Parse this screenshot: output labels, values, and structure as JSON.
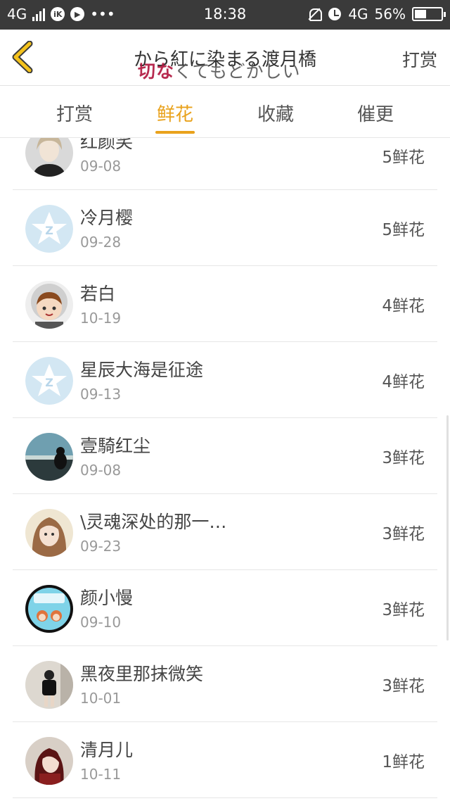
{
  "status_bar": {
    "network": "4G",
    "time": "18:38",
    "network_right": "4G",
    "battery": "56%",
    "more": "•••",
    "app_icon_label": "iK"
  },
  "header": {
    "title": "から紅に染まる渡月橋",
    "right_label": "打赏",
    "overlay_prefix": "切な",
    "overlay_rest": "くてもどかしい"
  },
  "tabs": [
    {
      "label": "打赏"
    },
    {
      "label": "鲜花"
    },
    {
      "label": "收藏"
    },
    {
      "label": "催更"
    }
  ],
  "rows": [
    {
      "name": "红颜笑",
      "date": "09-08",
      "amount": "5鲜花"
    },
    {
      "name": "冷月樱",
      "date": "09-28",
      "amount": "5鲜花"
    },
    {
      "name": "若白",
      "date": "10-19",
      "amount": "4鲜花"
    },
    {
      "name": "星辰大海是征途",
      "date": "09-13",
      "amount": "4鲜花"
    },
    {
      "name": "壹騎红尘",
      "date": "09-08",
      "amount": "3鲜花"
    },
    {
      "name": "\\灵魂深处的那一…",
      "date": "09-23",
      "amount": "3鲜花"
    },
    {
      "name": "颜小慢",
      "date": "09-10",
      "amount": "3鲜花"
    },
    {
      "name": "黑夜里那抹微笑",
      "date": "10-01",
      "amount": "3鲜花"
    },
    {
      "name": "清月儿",
      "date": "10-11",
      "amount": "1鲜花"
    }
  ],
  "colors": {
    "accent": "#e9a21c",
    "status_bar": "#3a3a3a",
    "overlay_red": "#b0143c"
  }
}
